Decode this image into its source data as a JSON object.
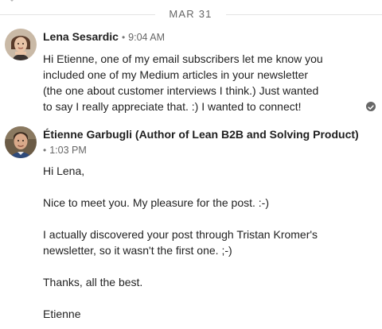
{
  "date_divider": {
    "label": "MAR 31"
  },
  "messages": [
    {
      "sender": "Lena Sesardic",
      "separator": "•",
      "time": "9:04 AM",
      "lines": [
        "Hi Etienne, one of my email subscribers let me know you",
        "included one of my Medium articles in your newsletter",
        "(the one about customer interviews I think.) Just wanted",
        "to say I really appreciate that. :) I wanted to connect!"
      ]
    },
    {
      "sender": "Étienne Garbugli (Author of Lean B2B and Solving Product)",
      "separator": "•",
      "time": "1:03 PM",
      "paragraphs": [
        "Hi Lena,",
        "Nice to meet you. My pleasure for the post. :-)",
        "I actually discovered your post through Tristan Kromer's",
        "newsletter, so it wasn't the first one. ;-)",
        "Thanks, all the best.",
        "Etienne"
      ]
    }
  ],
  "icons": {
    "read_receipt": "check-circle-icon",
    "avatar_lena": "avatar-photo",
    "avatar_etienne": "avatar-photo"
  },
  "colors": {
    "divider": "#e3e3e3",
    "meta_text": "#666666",
    "read_receipt": "#666666"
  }
}
